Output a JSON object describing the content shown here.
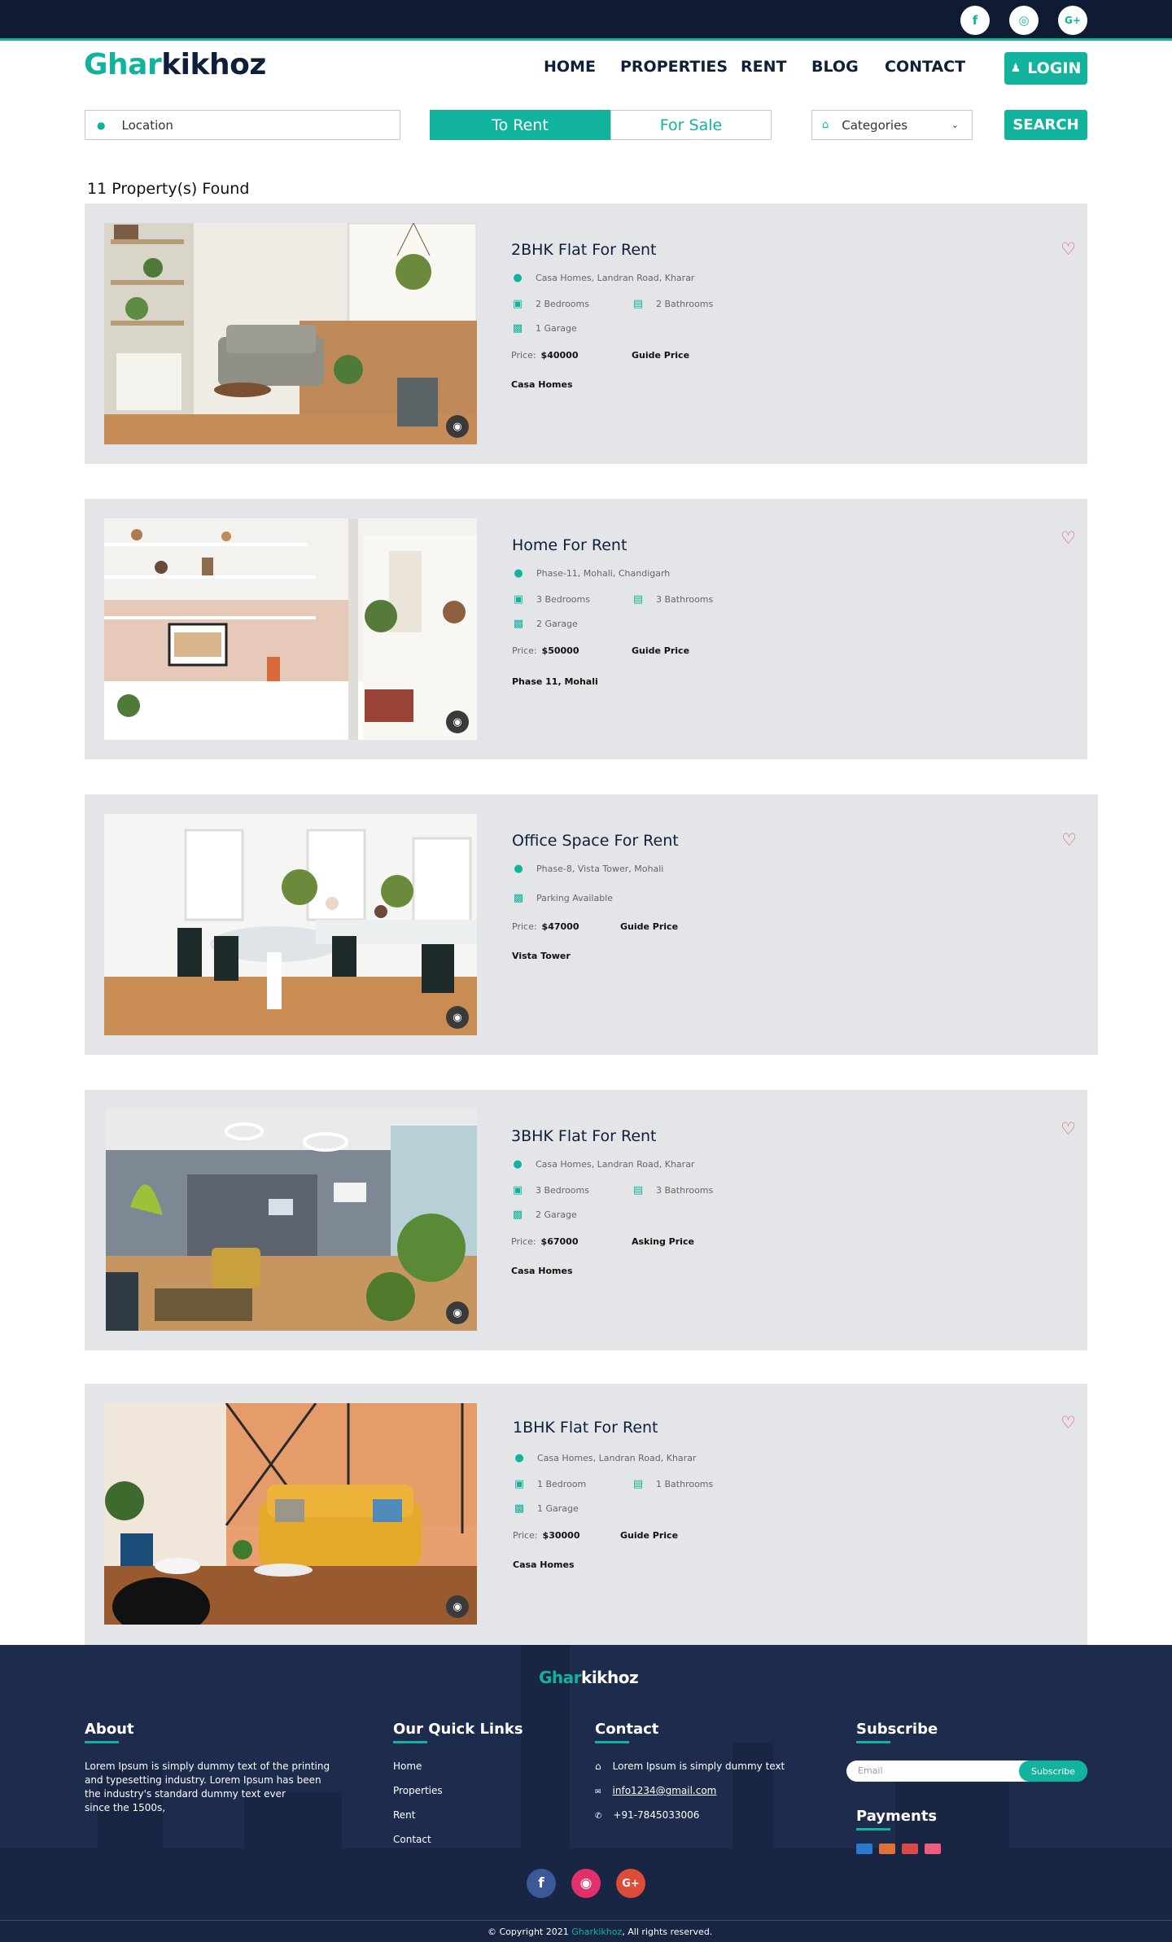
{
  "topbar": {
    "social": [
      "f",
      "◎",
      "G+"
    ]
  },
  "header": {
    "logo": {
      "part1": "Ghar",
      "part2": "kikhoz"
    },
    "nav": [
      "HOME",
      "PROPERTIES",
      "RENT",
      "BLOG",
      "CONTACT"
    ],
    "login_label": "LOGIN"
  },
  "search": {
    "location_placeholder": "Location",
    "tab_rent": "To Rent",
    "tab_sale": "For Sale",
    "categories": "Categories",
    "search_label": "SEARCH"
  },
  "results": {
    "count_text": "11 Property(s) Found"
  },
  "properties": [
    {
      "title": "2BHK Flat For Rent",
      "address": "Casa Homes, Landran Road, Kharar",
      "bedrooms": "2 Bedrooms",
      "bathrooms": "2 Bathrooms",
      "garage": "1 Garage",
      "price_label": "Price:",
      "price": "$40000",
      "price_type": "Guide Price",
      "owner": "Casa Homes"
    },
    {
      "title": "Home For Rent",
      "address": "Phase-11, Mohali, Chandigarh",
      "bedrooms": "3 Bedrooms",
      "bathrooms": "3 Bathrooms",
      "garage": "2 Garage",
      "price_label": "Price:",
      "price": "$50000",
      "price_type": "Guide Price",
      "owner": "Phase 11, Mohali"
    },
    {
      "title": "Office Space For Rent",
      "address": "Phase-8, Vista Tower, Mohali",
      "parking": "Parking Available",
      "price_label": "Price:",
      "price": "$47000",
      "price_type": "Guide Price",
      "owner": "Vista Tower"
    },
    {
      "title": "3BHK Flat For Rent",
      "address": "Casa Homes, Landran Road, Kharar",
      "bedrooms": "3 Bedrooms",
      "bathrooms": "3 Bathrooms",
      "garage": "2 Garage",
      "price_label": "Price:",
      "price": "$67000",
      "price_type": "Asking Price",
      "owner": "Casa Homes"
    },
    {
      "title": "1BHK Flat For Rent",
      "address": "Casa Homes, Landran Road, Kharar",
      "bedrooms": "1 Bedroom",
      "bathrooms": "1 Bathrooms",
      "garage": "1 Garage",
      "price_label": "Price:",
      "price": "$30000",
      "price_type": "Guide Price",
      "owner": "Casa Homes"
    }
  ],
  "footer": {
    "logo": {
      "part1": "Ghar",
      "part2": "kikhoz"
    },
    "about_title": "About",
    "about_lines": [
      "Lorem Ipsum is simply dummy text of the printing",
      "and typesetting industry. Lorem Ipsum has been",
      "the industry's standard dummy text ever",
      "since the 1500s,"
    ],
    "links_title": "Our Quick Links",
    "links": [
      "Home",
      "Properties",
      "Rent",
      "Contact"
    ],
    "contact_title": "Contact",
    "contact_address": "Lorem Ipsum is simply dummy text",
    "contact_email": "info1234@gmail.com",
    "contact_phone": "+91-7845033006",
    "subscribe_title": "Subscribe",
    "email_placeholder": "Email",
    "subscribe_button": "Subscribe",
    "payments_title": "Payments",
    "copyright_prefix": "Copyright 2021",
    "copyright_brand": "Gharkikhoz",
    "copyright_suffix": ", All rights reserved."
  },
  "colors": {
    "accent": "#12b39c",
    "navy": "#0f1a33",
    "card_bg": "#e4e5e8",
    "footer_bg": "#1d2c4c"
  }
}
